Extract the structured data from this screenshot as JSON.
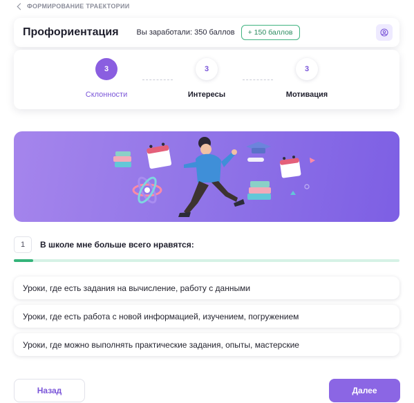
{
  "breadcrumb": {
    "label": "ФОРМИРОВАНИЕ ТРАЕКТОРИИ",
    "icon": "chevron-left-icon"
  },
  "header": {
    "title": "Профориентация",
    "earned": "Вы заработали: 350 баллов",
    "bonus": "+ 150 баллов",
    "profile_icon": "user-circle-icon"
  },
  "steps": [
    {
      "number": "3",
      "label": "Склонности",
      "active": true
    },
    {
      "number": "3",
      "label": "Интересы",
      "active": false
    },
    {
      "number": "3",
      "label": "Мотивация",
      "active": false
    }
  ],
  "banner": {
    "illustration": "student-with-books-illustration"
  },
  "question": {
    "number": "1",
    "text": "В школе мне больше всего нравятся:",
    "progress": 0.05
  },
  "answers": [
    "Уроки, где есть задания на вычисление, работу с данными",
    "Уроки, где есть работа с новой информацией, изучением, погружением",
    "Уроки, где можно выполнять практические задания, опыты, мастерские"
  ],
  "buttons": {
    "back": "Назад",
    "next": "Далее"
  },
  "colors": {
    "accent": "#8b66e4",
    "success": "#35b47a",
    "banner_start": "#a585ec",
    "banner_end": "#7d5fe4"
  }
}
